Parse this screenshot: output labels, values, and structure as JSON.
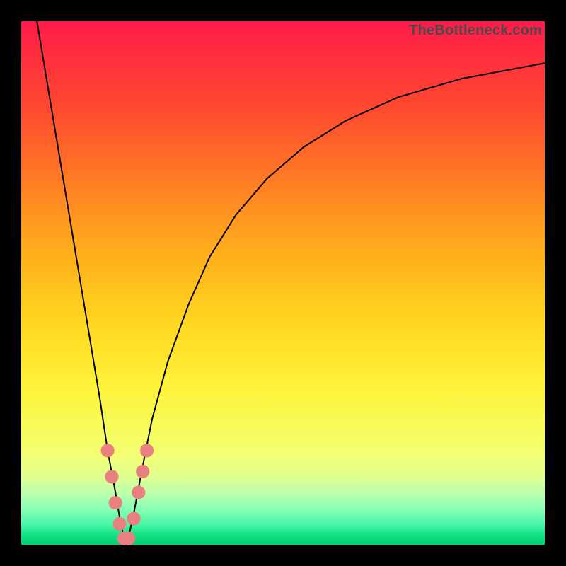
{
  "watermark": {
    "text": "TheBottleneck.com"
  },
  "frame": {
    "outer_w": 800,
    "outer_h": 800,
    "inner_left": 30,
    "inner_top": 30,
    "inner_w": 740,
    "inner_h": 740
  },
  "chart_data": {
    "type": "line",
    "title": "",
    "xlabel": "",
    "ylabel": "",
    "xlim": [
      0,
      100
    ],
    "ylim": [
      0,
      100
    ],
    "grid": false,
    "series": [
      {
        "name": "bottleneck-curve",
        "x": [
          3,
          5,
          7,
          9,
          11,
          13,
          15,
          16.5,
          18,
          19,
          19.8,
          20.5,
          21.5,
          23,
          25,
          28,
          32,
          36,
          41,
          47,
          54,
          62,
          72,
          84,
          100
        ],
        "y": [
          100,
          88,
          76,
          64,
          52,
          40,
          28,
          18,
          10,
          4,
          0.8,
          1.5,
          6,
          14,
          24,
          35,
          46,
          55,
          63,
          70,
          76,
          81,
          85.5,
          89,
          92
        ]
      }
    ],
    "markers": {
      "name": "highlighted-points",
      "radius_pct": 1.3,
      "points": [
        {
          "x": 16.5,
          "y": 18
        },
        {
          "x": 17.3,
          "y": 13
        },
        {
          "x": 18.0,
          "y": 8
        },
        {
          "x": 18.8,
          "y": 4
        },
        {
          "x": 19.6,
          "y": 1.2
        },
        {
          "x": 20.5,
          "y": 1.2
        },
        {
          "x": 21.5,
          "y": 5
        },
        {
          "x": 22.4,
          "y": 10
        },
        {
          "x": 23.2,
          "y": 14
        },
        {
          "x": 24.0,
          "y": 18
        }
      ]
    },
    "background_gradient": {
      "top": "#ff1a49",
      "mid": "#ffe228",
      "bottom": "#00d06f"
    }
  }
}
